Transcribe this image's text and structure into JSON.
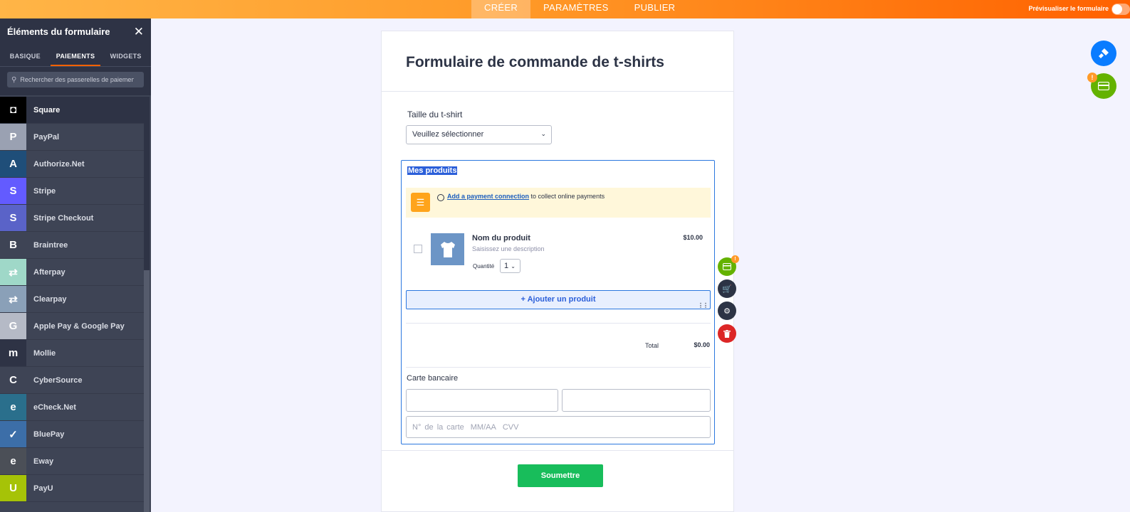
{
  "topbar": {
    "tabs": [
      "CRÉER",
      "PARAMÈTRES",
      "PUBLIER"
    ],
    "preview_label": "Prévisualiser le formulaire"
  },
  "sidebar": {
    "title": "Éléments du formulaire",
    "tabs": [
      "BASIQUE",
      "PAIEMENTS",
      "WIDGETS"
    ],
    "search_placeholder": "Rechercher des passerelles de paiement",
    "items": [
      {
        "label": "Square",
        "icon": "square-logo-icon",
        "color": "#000000",
        "glyph": "◘"
      },
      {
        "label": "PayPal",
        "icon": "paypal-logo-icon",
        "color": "#9aa1b2",
        "glyph": "P"
      },
      {
        "label": "Authorize.Net",
        "icon": "authorize-net-logo-icon",
        "color": "#1f4e79",
        "glyph": "A"
      },
      {
        "label": "Stripe",
        "icon": "stripe-logo-icon",
        "color": "#635bff",
        "glyph": "S"
      },
      {
        "label": "Stripe Checkout",
        "icon": "stripe-checkout-logo-icon",
        "color": "#5a63c8",
        "glyph": "S"
      },
      {
        "label": "Braintree",
        "icon": "braintree-logo-icon",
        "color": "#3e4455",
        "glyph": "B"
      },
      {
        "label": "Afterpay",
        "icon": "afterpay-logo-icon",
        "color": "#9fd8c8",
        "glyph": "⇄"
      },
      {
        "label": "Clearpay",
        "icon": "clearpay-logo-icon",
        "color": "#8aa0b8",
        "glyph": "⇄"
      },
      {
        "label": "Apple Pay & Google Pay",
        "icon": "apple-google-pay-logo-icon",
        "color": "#b5bac6",
        "glyph": "G"
      },
      {
        "label": "Mollie",
        "icon": "mollie-logo-icon",
        "color": "#2e3345",
        "glyph": "m"
      },
      {
        "label": "CyberSource",
        "icon": "cybersource-logo-icon",
        "color": "#3e4455",
        "glyph": "C"
      },
      {
        "label": "eCheck.Net",
        "icon": "echeck-net-logo-icon",
        "color": "#2a6f8c",
        "glyph": "e"
      },
      {
        "label": "BluePay",
        "icon": "bluepay-logo-icon",
        "color": "#3c6ea8",
        "glyph": "✓"
      },
      {
        "label": "Eway",
        "icon": "eway-logo-icon",
        "color": "#4b4f57",
        "glyph": "e"
      },
      {
        "label": "PayU",
        "icon": "payu-logo-icon",
        "color": "#a6c307",
        "glyph": "U"
      }
    ]
  },
  "form": {
    "title": "Formulaire de commande de t-shirts",
    "size_label": "Taille du t-shirt",
    "size_select_value": "Veuillez sélectionner",
    "products": {
      "title": "Mes produits",
      "notice_link": "Add a payment connection",
      "notice_rest": " to collect online payments",
      "product_name": "Nom du produit",
      "product_desc": "Saisissez une description",
      "quantity_label": "Quantité",
      "quantity_value": "1",
      "price": "$10.00",
      "add_product": "+ Ajouter un produit",
      "total_label": "Total",
      "total_value": "$0.00",
      "card_label": "Carte bancaire",
      "card_placeholders": [
        "N° de la carte",
        "MM/AA",
        "CVV"
      ]
    },
    "submit_label": "Soumettre"
  },
  "badges": {
    "alert": "!"
  },
  "colors": {
    "accent": "#ff6100",
    "primary_blue": "#2b77df",
    "submit_green": "#18bd5b"
  }
}
